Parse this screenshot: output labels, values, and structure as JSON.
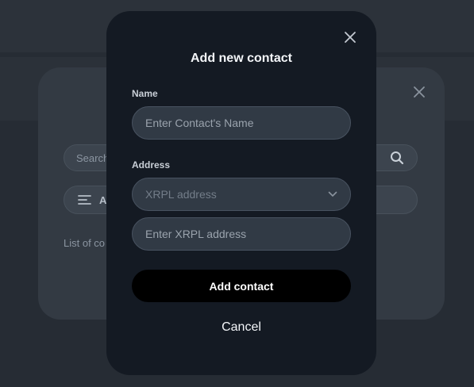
{
  "background": {
    "search_placeholder": "Search",
    "filter_label": "A",
    "list_text": "List of co",
    "close_icon": "close-icon",
    "search_icon": "search-icon",
    "filter_icon": "filter-lines-icon"
  },
  "modal": {
    "title": "Add new contact",
    "close_icon": "close-icon",
    "name_label": "Name",
    "name_placeholder": "Enter Contact's Name",
    "address_label": "Address",
    "network_select_value": "XRPL address",
    "address_placeholder": "Enter XRPL address",
    "submit_label": "Add contact",
    "cancel_label": "Cancel"
  },
  "colors": {
    "backdrop": "#262c34",
    "panel": "#333a43",
    "modal": "#141a23",
    "field": "#313a45",
    "primary_button": "#000000",
    "text": "#f3f5f8"
  }
}
